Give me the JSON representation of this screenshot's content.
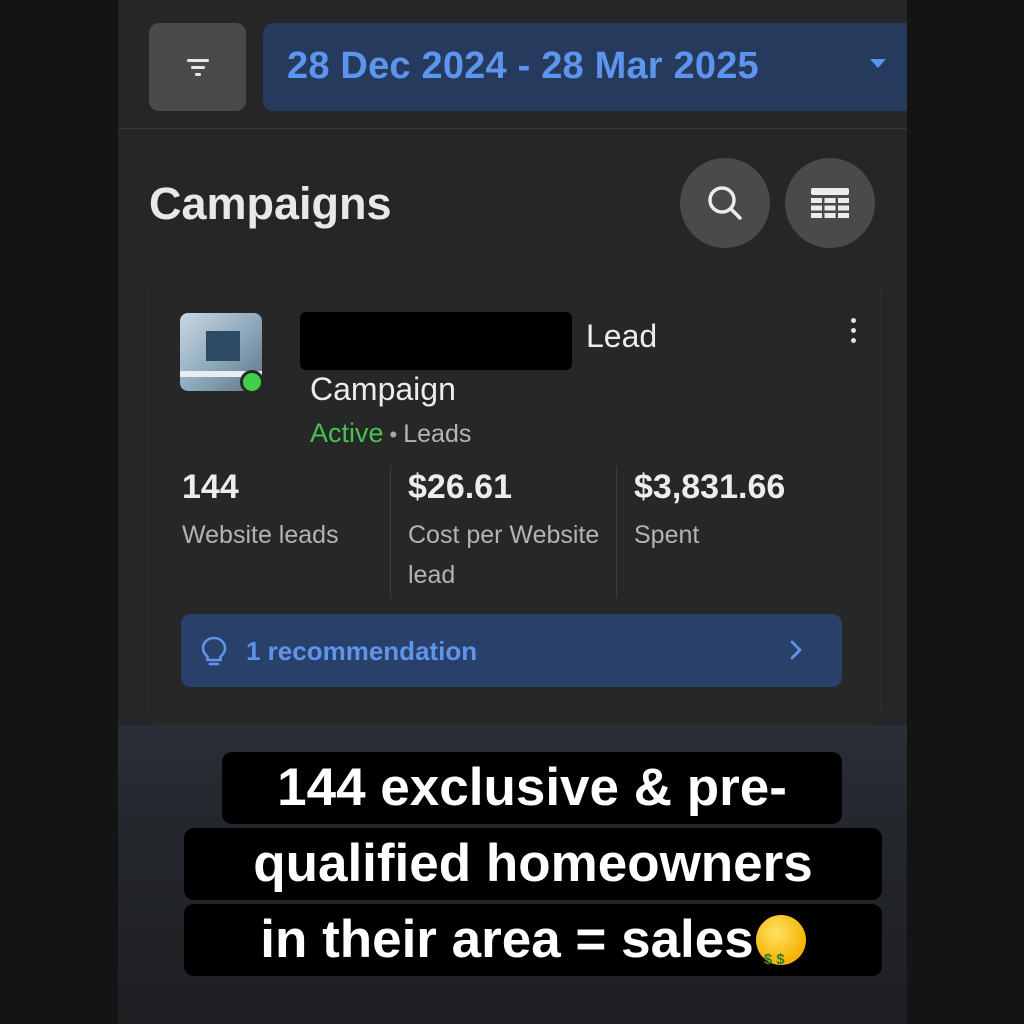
{
  "header": {
    "date_range": "28 Dec 2024 - 28 Mar 2025"
  },
  "page": {
    "title": "Campaigns"
  },
  "campaign": {
    "name_suffix": "Lead",
    "name_line2": "Campaign",
    "status": "Active",
    "separator": "•",
    "objective": "Leads",
    "metrics": [
      {
        "value": "144",
        "label": "Website leads"
      },
      {
        "value": "$26.61",
        "label": "Cost per Website lead"
      },
      {
        "value": "$3,831.66",
        "label": "Spent"
      }
    ],
    "recommendation": "1 recommendation"
  },
  "caption": {
    "line1": "144 exclusive & pre-",
    "line2": "qualified homeowners",
    "line3": "in their area = sales"
  },
  "icons": {
    "filter": "filter-icon",
    "date_caret": "caret-down-icon",
    "search": "search-icon",
    "table": "table-icon",
    "more": "more-vertical-icon",
    "recommendation": "lightbulb-icon",
    "chevron": "chevron-right-icon",
    "emoji": "money-mouth-face-icon"
  },
  "colors": {
    "accent_blue": "#5d94ee",
    "active_green": "#46c24f",
    "status_dot": "#3fd14a"
  }
}
